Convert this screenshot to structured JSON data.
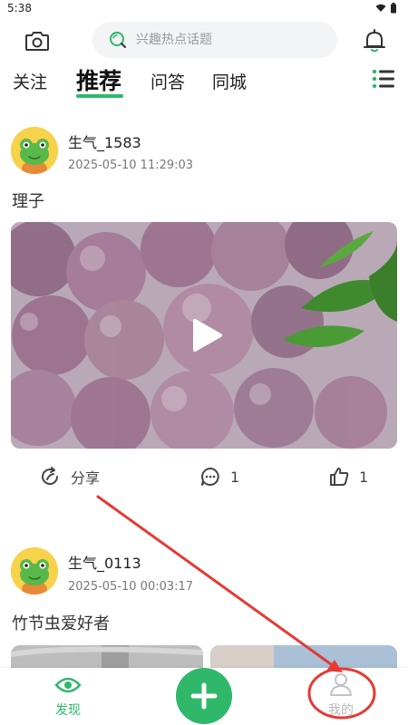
{
  "status_bar": {
    "time": "5:38"
  },
  "search": {
    "placeholder": "兴趣热点话题"
  },
  "tabs": [
    {
      "label": "关注",
      "active": false
    },
    {
      "label": "推荐",
      "active": true
    },
    {
      "label": "问答",
      "active": false
    },
    {
      "label": "同城",
      "active": false
    }
  ],
  "posts": [
    {
      "username": "生气_1583",
      "timestamp": "2025-05-10 11:29:03",
      "title": "理子",
      "media": "video",
      "share_label": "分享",
      "comment_count": "1",
      "like_count": "1"
    },
    {
      "username": "生气_0113",
      "timestamp": "2025-05-10 00:03:17",
      "title": "竹节虫爱好者"
    }
  ],
  "bottom_nav": {
    "discover_label": "发现",
    "mine_label": "我的"
  },
  "colors": {
    "accent": "#2fb86a",
    "annotation": "#e53935"
  },
  "icons": [
    "camera-icon",
    "search-icon",
    "bell-icon",
    "menu-list-icon",
    "share-icon",
    "comment-icon",
    "like-icon",
    "eye-icon",
    "plus-icon",
    "person-icon",
    "play-icon"
  ]
}
